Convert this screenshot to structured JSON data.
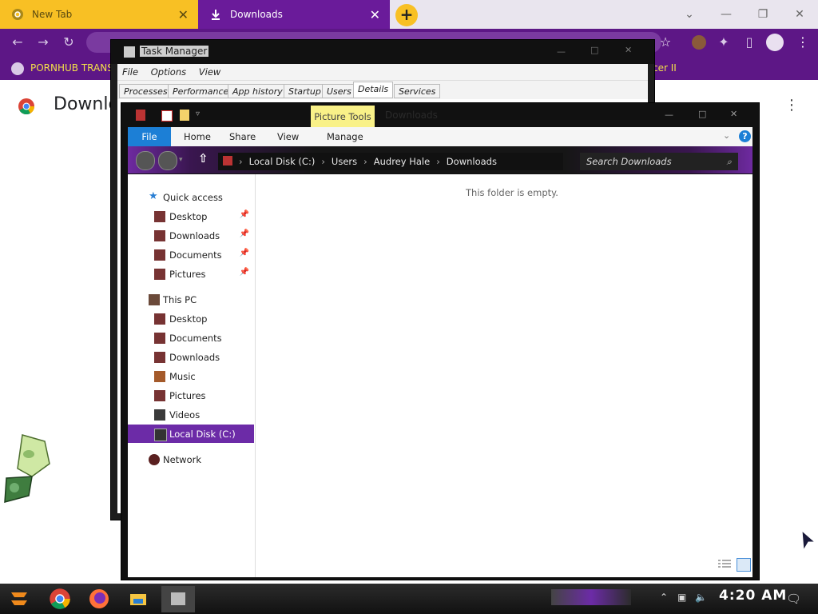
{
  "browser": {
    "tabs": [
      {
        "label": "New Tab",
        "icon": "chrome-icon"
      },
      {
        "label": "Downloads",
        "icon": "download-icon"
      }
    ],
    "bookmark": "PORNHUB TRANS",
    "bookmark_right": "cer II",
    "page_title": "Downlo"
  },
  "task_manager": {
    "title": "Task Manager",
    "menu": [
      "File",
      "Options",
      "View"
    ],
    "tabs": [
      "Processes",
      "Performance",
      "App history",
      "Startup",
      "Users",
      "Details",
      "Services"
    ],
    "active_tab": "Details"
  },
  "explorer": {
    "ribbon": {
      "file": "File",
      "home": "Home",
      "share": "Share",
      "view": "View",
      "manage": "Manage",
      "context_tab": "Picture Tools",
      "title_hint": "Downloads"
    },
    "address": {
      "crumbs": [
        "Local Disk (C:)",
        "Users",
        "Audrey Hale",
        "Downloads"
      ],
      "search_placeholder": "Search Downloads"
    },
    "nav": {
      "quick_access": "Quick access",
      "quick_items": [
        "Desktop",
        "Downloads",
        "Documents",
        "Pictures"
      ],
      "this_pc": "This PC",
      "pc_items": [
        "Desktop",
        "Documents",
        "Downloads",
        "Music",
        "Pictures",
        "Videos"
      ],
      "local_disk": "Local Disk (C:)",
      "network": "Network"
    },
    "empty_message": "This folder is empty."
  },
  "taskbar": {
    "clock": "4:20 AM"
  },
  "colors": {
    "accent_purple": "#6c2ba7",
    "tab_yellow": "#f8c024",
    "file_blue": "#1c7fd6"
  }
}
